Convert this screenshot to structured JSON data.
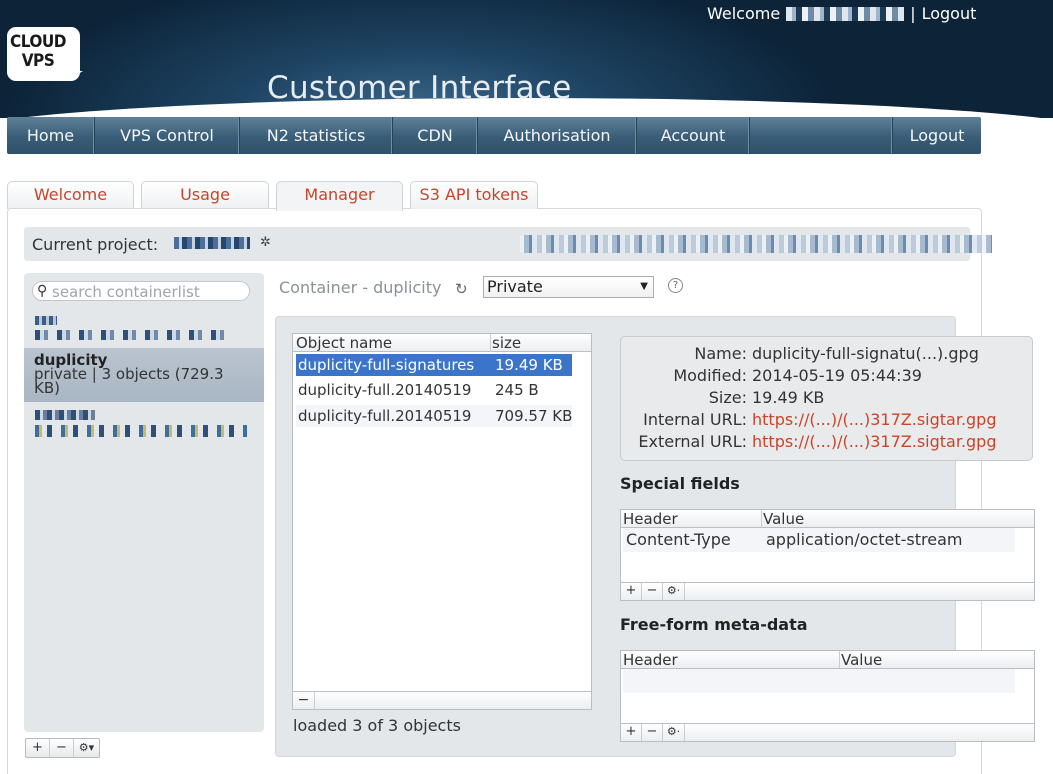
{
  "header": {
    "logo_line1": "CLOUD",
    "logo_line2": "VPS",
    "app_title": "Customer Interface",
    "welcome_label": "Welcome",
    "separator": "|",
    "logout_link": "Logout"
  },
  "nav": {
    "items": [
      "Home",
      "VPS Control",
      "N2 statistics",
      "CDN",
      "Authorisation",
      "Account"
    ],
    "logout": "Logout"
  },
  "tabs": [
    "Welcome",
    "Usage",
    "Manager",
    "S3 API tokens"
  ],
  "active_tab": "Manager",
  "project": {
    "label": "Current project:"
  },
  "containers": {
    "search_placeholder": "search containerlist",
    "selected": {
      "name": "duplicity",
      "meta": "private | 3 objects (729.3 KB)"
    },
    "tools": [
      "+",
      "−",
      "⚙▾"
    ]
  },
  "container_view": {
    "label": "Container - duplicity",
    "access_value": "Private",
    "help": "?"
  },
  "objects": {
    "columns": [
      "Object name",
      "size"
    ],
    "rows": [
      {
        "name": "duplicity-full-signatures",
        "size": "19.49 KB"
      },
      {
        "name": "duplicity-full.20140519",
        "size": "245 B"
      },
      {
        "name": "duplicity-full.20140519",
        "size": "709.57 KB"
      }
    ],
    "remove_button": "−",
    "loaded_text": "loaded 3 of 3 objects"
  },
  "details": {
    "name_label": "Name:",
    "name_value": "duplicity-full-signatu(...).gpg",
    "modified_label": "Modified:",
    "modified_value": "2014-05-19 05:44:39",
    "size_label": "Size:",
    "size_value": "19.49 KB",
    "internal_label": "Internal URL:",
    "internal_value": "https://(...)/(...)317Z.sigtar.gpg",
    "external_label": "External URL:",
    "external_value": "https://(...)/(...)317Z.sigtar.gpg"
  },
  "special_fields": {
    "title": "Special fields",
    "columns": [
      "Header",
      "Value"
    ],
    "rows": [
      {
        "header": "Content-Type",
        "value": "application/octet-stream"
      }
    ],
    "tools": [
      "+",
      "−",
      "⚙·"
    ]
  },
  "meta_data": {
    "title": "Free-form meta-data",
    "columns": [
      "Header",
      "Value"
    ],
    "tools": [
      "+",
      "−",
      "⚙·"
    ]
  },
  "colors": {
    "accent_link": "#c8452a",
    "selection": "#3b75c9",
    "nav_bar": "#3a5d77",
    "header_bg": "#0c2338"
  }
}
